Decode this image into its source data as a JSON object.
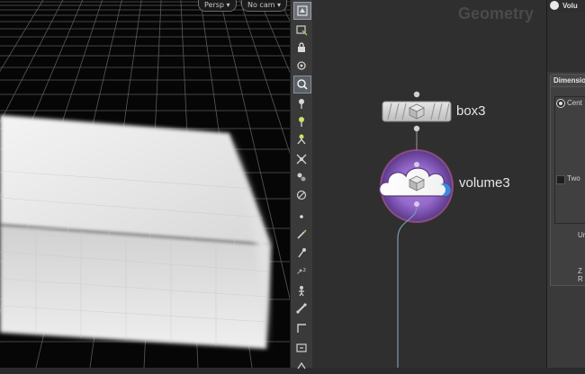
{
  "viewport": {
    "camera_menu": "Persp",
    "cam_menu": "No cam"
  },
  "toolbar": {
    "items": [
      "select-tool",
      "transform-tool",
      "lock-tool",
      "view-tool",
      "camera-tool",
      "light-tool",
      "light-bulb-tool",
      "handle-tool",
      "snap-tool",
      "group-tool",
      "render-region-tool",
      "point-tool",
      "edit-tool",
      "brush-tool",
      "scale-tool",
      "pose-tool",
      "bone-tool",
      "corner-tool",
      "display-tool"
    ]
  },
  "network": {
    "context_label": "Geometry",
    "nodes": [
      {
        "name": "box3"
      },
      {
        "name": "volume3"
      }
    ]
  },
  "parameters": {
    "header_title": "Volu",
    "section_tab": "Dimensio",
    "radio_label": "Cent",
    "checkbox_label": "Two",
    "field1_label": "Un",
    "field2_label": "Z R"
  }
}
